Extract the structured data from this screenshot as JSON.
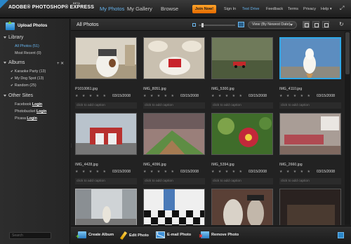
{
  "app": {
    "logo": "ADOBE® PHOTOSHOP® EXPRESS",
    "beta": "BETA"
  },
  "topnav": {
    "my_photos": "My Photos",
    "my_gallery": "My Gallery",
    "browse": "Browse"
  },
  "toplinks": {
    "join": "Join Now!",
    "sign_in": "Sign In",
    "test_drive": "Test Drive",
    "feedback": "Feedback",
    "terms": "Terms",
    "privacy": "Privacy",
    "help": "Help ▾"
  },
  "sidebar": {
    "upload": "Upload Photos",
    "library_title": "Library",
    "library": [
      "All Photos (51)",
      "Most Recent (0)"
    ],
    "albums_title": "Albums",
    "album_tools": "+ ✕",
    "albums": [
      "Karaoke Party (13)",
      "My Dog Spot (13)",
      "Random (25)"
    ],
    "other_title": "Other Sites",
    "sites": [
      {
        "name": "Facebook",
        "link": "Login"
      },
      {
        "name": "Photobucket",
        "link": "Login"
      },
      {
        "name": "Picasa",
        "link": "Login"
      }
    ],
    "search_placeholder": "Search"
  },
  "content": {
    "title": "All Photos",
    "view_select": "View (By Newest Date)"
  },
  "photos": [
    {
      "name": "P1010061.jpg",
      "date": "03/15/2008",
      "caption": "click to add caption",
      "stars": "★ ★ ★ ★ ★"
    },
    {
      "name": "IMG_8051.jpg",
      "date": "03/15/2008",
      "caption": "click to add caption",
      "stars": "★ ★ ★ ★ ★"
    },
    {
      "name": "IMG_5300.jpg",
      "date": "03/15/2008",
      "caption": "click to add caption",
      "stars": "★ ★ ★ ★ ★"
    },
    {
      "name": "IMG_4110.jpg",
      "date": "03/15/2008",
      "caption": "click to add caption",
      "stars": "★ ★ ★ ★ ★"
    },
    {
      "name": "IMG_4428.jpg",
      "date": "03/15/2008",
      "caption": "click to add caption",
      "stars": "★ ★ ★ ★ ★"
    },
    {
      "name": "IMG_4096.jpg",
      "date": "03/15/2008",
      "caption": "click to add caption",
      "stars": "★ ★ ★ ★ ★"
    },
    {
      "name": "IMG_5394.jpg",
      "date": "03/15/2008",
      "caption": "click to add caption",
      "stars": "★ ★ ★ ★ ★"
    },
    {
      "name": "IMG_2660.jpg",
      "date": "03/15/2008",
      "caption": "click to add caption",
      "stars": "★ ★ ★ ★ ★"
    }
  ],
  "toolbar": {
    "create_album": "Create Album",
    "edit_photo": "Edit Photo",
    "email_photo": "E-mail Photo",
    "remove_photo": "Remove Photo"
  },
  "colors": {
    "accent": "#2fa8e8",
    "join": "#f08a10",
    "bg": "#222222"
  }
}
